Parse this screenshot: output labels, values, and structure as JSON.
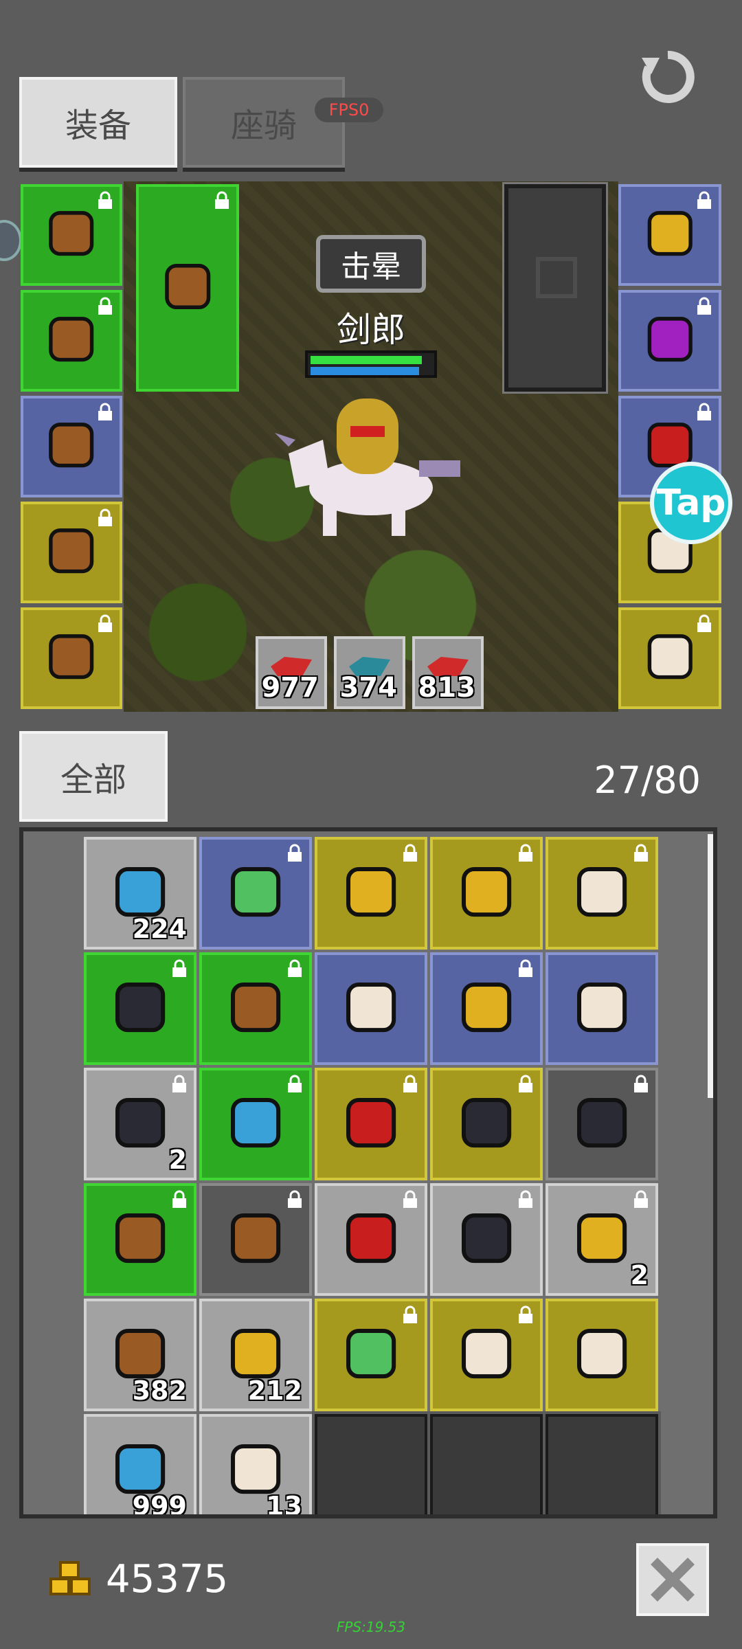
{
  "tabs": [
    {
      "label": "装备",
      "active": true
    },
    {
      "label": "座骑",
      "active": false
    }
  ],
  "fps_badge": "FPS0",
  "refresh_icon": "refresh-icon",
  "character": {
    "status": "击晕",
    "name": "剑郎",
    "hp_fraction": 0.88,
    "mp_fraction": 0.86
  },
  "resources": [
    {
      "icon": "red-crystal-icon",
      "qty": "977"
    },
    {
      "icon": "teal-crystal-icon",
      "qty": "374"
    },
    {
      "icon": "red-crystal-icon",
      "qty": "813"
    }
  ],
  "tap_label": "Tap",
  "equip_left": [
    {
      "icon": "helmet-icon",
      "rarity": "green"
    },
    {
      "icon": "chest-armor-icon",
      "rarity": "green"
    },
    {
      "icon": "gauntlet-icon",
      "rarity": "blue"
    },
    {
      "icon": "boots-icon",
      "rarity": "yellow"
    },
    {
      "icon": "belt-icon",
      "rarity": "yellow"
    }
  ],
  "equip_weapon": {
    "icon": "pickaxe-icon",
    "rarity": "green"
  },
  "equip_right": [
    {
      "icon": "necklace-icon",
      "rarity": "blue"
    },
    {
      "icon": "purple-ring-icon",
      "rarity": "blue"
    },
    {
      "icon": "red-ring-icon",
      "rarity": "blue"
    },
    {
      "icon": "unicorn-card-icon",
      "rarity": "yellow"
    },
    {
      "icon": "fox-card-icon",
      "rarity": "yellow"
    }
  ],
  "filter_label": "全部",
  "inventory_count": "27/80",
  "inventory": [
    [
      {
        "icon": "blue-feather-icon",
        "rarity": "white",
        "qty": "224",
        "lock": false
      },
      {
        "icon": "emerald-ring-icon",
        "rarity": "blue",
        "qty": "",
        "lock": true
      },
      {
        "icon": "gold-ring-icon",
        "rarity": "yellow",
        "qty": "",
        "lock": true
      },
      {
        "icon": "gold-necklace-icon",
        "rarity": "yellow",
        "qty": "",
        "lock": true
      },
      {
        "icon": "cat-card-icon",
        "rarity": "yellow",
        "qty": "",
        "lock": true
      }
    ],
    [
      {
        "icon": "dark-hat-icon",
        "rarity": "green",
        "qty": "",
        "lock": true
      },
      {
        "icon": "chest-armor-icon",
        "rarity": "green",
        "qty": "",
        "lock": true
      },
      {
        "icon": "egg-icon",
        "rarity": "blue",
        "qty": "",
        "lock": false
      },
      {
        "icon": "golden-shield-icon",
        "rarity": "blue",
        "qty": "",
        "lock": true
      },
      {
        "icon": "unicorn-card-icon",
        "rarity": "blue",
        "qty": "",
        "lock": false
      }
    ],
    [
      {
        "icon": "dark-ore-icon",
        "rarity": "white",
        "qty": "2",
        "lock": true
      },
      {
        "icon": "blue-tunic-icon",
        "rarity": "green",
        "qty": "",
        "lock": true
      },
      {
        "icon": "red-axe-icon",
        "rarity": "yellow",
        "qty": "",
        "lock": true
      },
      {
        "icon": "horned-mount-icon",
        "rarity": "yellow",
        "qty": "",
        "lock": true
      },
      {
        "icon": "horned-mount-icon",
        "rarity": "dark",
        "qty": "",
        "lock": true
      }
    ],
    [
      {
        "icon": "helmet-icon",
        "rarity": "green",
        "qty": "",
        "lock": true
      },
      {
        "icon": "leather-armor-icon",
        "rarity": "dark",
        "qty": "",
        "lock": true
      },
      {
        "icon": "red-gem-icon",
        "rarity": "white",
        "qty": "",
        "lock": true
      },
      {
        "icon": "grey-gem-icon",
        "rarity": "white",
        "qty": "",
        "lock": true
      },
      {
        "icon": "yellow-gem-icon",
        "rarity": "white",
        "qty": "2",
        "lock": true
      }
    ],
    [
      {
        "icon": "bread-icon",
        "rarity": "white",
        "qty": "382",
        "lock": false
      },
      {
        "icon": "cheese-icon",
        "rarity": "white",
        "qty": "212",
        "lock": false
      },
      {
        "icon": "frog-card-icon",
        "rarity": "yellow",
        "qty": "",
        "lock": true
      },
      {
        "icon": "cat-card-icon",
        "rarity": "yellow",
        "qty": "",
        "lock": true
      },
      {
        "icon": "orange-egg-icon",
        "rarity": "yellow",
        "qty": "",
        "lock": false
      }
    ],
    [
      {
        "icon": "fish-icon",
        "rarity": "white",
        "qty": "999",
        "lock": false
      },
      {
        "icon": "scroll-icon",
        "rarity": "white",
        "qty": "13",
        "lock": false
      },
      {
        "icon": "",
        "rarity": "empty",
        "qty": "",
        "lock": false
      },
      {
        "icon": "",
        "rarity": "empty",
        "qty": "",
        "lock": false
      },
      {
        "icon": "",
        "rarity": "empty",
        "qty": "",
        "lock": false
      }
    ]
  ],
  "gold": "45375",
  "close_icon": "close-icon",
  "fps_bottom": "FPS:19.53",
  "colors": {
    "green": "#2cab22",
    "blue": "#5664a4",
    "yellow": "#a69a1e",
    "white": "#a2a2a2",
    "dark": "#585858",
    "tap": "#1fc6d2"
  }
}
